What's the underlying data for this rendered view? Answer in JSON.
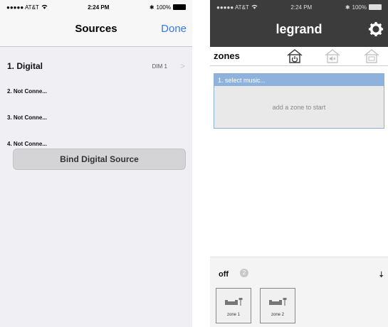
{
  "left": {
    "status": {
      "carrier": "●●●●● AT&T",
      "time": "2:24 PM",
      "battery": "100%",
      "battery_level": 1.0
    },
    "nav": {
      "title": "Sources",
      "done_label": "Done"
    },
    "rows": [
      {
        "label": "1. Digital",
        "detail": "DIM 1",
        "chevron": ">"
      },
      {
        "label": "2. Not Conne...",
        "detail": "",
        "chevron": ""
      },
      {
        "label": "3. Not Conne...",
        "detail": "",
        "chevron": ""
      },
      {
        "label": "4. Not Conne...",
        "detail": "",
        "chevron": ""
      }
    ],
    "bind_button_label": "Bind Digital Source"
  },
  "right": {
    "status": {
      "carrier": "●●●●● AT&T",
      "time": "2:24 PM",
      "battery": "100%",
      "battery_level": 1.0
    },
    "brand": "legrand",
    "zones_label": "zones",
    "select_head": "1. select music...",
    "select_body": "add a zone to start",
    "off_label": "off",
    "off_count": "2",
    "zone_tiles": [
      {
        "name": "zone 1"
      },
      {
        "name": "zone 2"
      }
    ],
    "colors": {
      "header_bg": "#3c3c3c",
      "accent_blue": "#8fb2dc",
      "ios_blue": "#3478f6"
    }
  }
}
